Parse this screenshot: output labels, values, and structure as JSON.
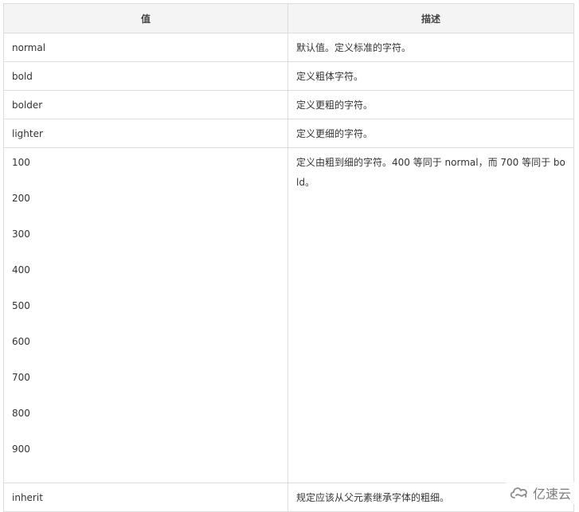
{
  "table": {
    "headers": [
      "值",
      "描述"
    ],
    "rows": [
      {
        "value": "normal",
        "description": "默认值。定义标准的字符。"
      },
      {
        "value": "bold",
        "description": "定义粗体字符。"
      },
      {
        "value": "bolder",
        "description": "定义更粗的字符。"
      },
      {
        "value": "lighter",
        "description": "定义更细的字符。"
      },
      {
        "values": [
          "100",
          "200",
          "300",
          "400",
          "500",
          "600",
          "700",
          "800",
          "900"
        ],
        "description": "定义由粗到细的字符。400 等同于 normal，而 700 等同于 bold。"
      },
      {
        "value": "inherit",
        "description": "规定应该从父元素继承字体的粗细。"
      }
    ]
  },
  "watermark": {
    "text": "亿速云",
    "icon": "cloud-logo-icon"
  }
}
